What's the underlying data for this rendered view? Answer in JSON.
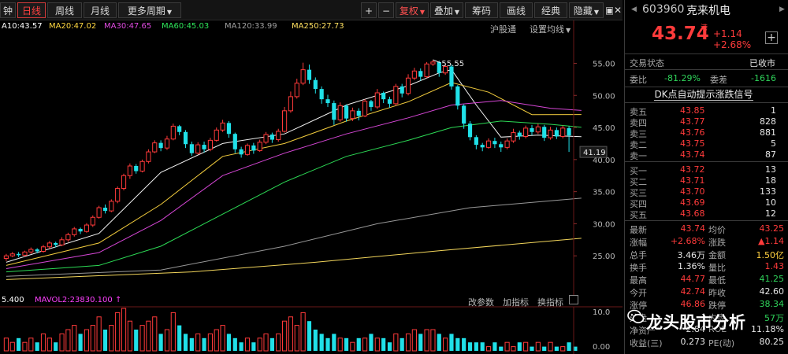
{
  "toolbar": {
    "tabs": [
      "钟",
      "日线",
      "周线",
      "月线",
      "更多周期"
    ],
    "active_tab": "日线",
    "buttons": [
      "+",
      "−",
      "复权",
      "叠加",
      "筹码",
      "画线",
      "经典",
      "隐藏"
    ],
    "window": [
      "▣",
      "✕"
    ]
  },
  "ma_legend": [
    {
      "text": "A10:43.57",
      "color": "#ffffff"
    },
    {
      "text": "MA20:47.02",
      "color": "#ffd740"
    },
    {
      "text": "MA30:47.65",
      "color": "#e04ae0"
    },
    {
      "text": "MA60:45.03",
      "color": "#2ee65a"
    },
    {
      "text": "MA120:33.99",
      "color": "#a0a0a0"
    },
    {
      "text": "MA250:27.73",
      "color": "#ffe060"
    }
  ],
  "right_links": [
    "沪股通",
    "设置均线"
  ],
  "axis": {
    "price_ticks": [
      "55.00",
      "50.00",
      "45.00",
      "40.00",
      "35.00",
      "30.00",
      "25.00"
    ],
    "current_price_label": "41.19",
    "high_marker": "55.55",
    "vol_ticks": [
      "10.0",
      "0.00"
    ]
  },
  "vol_header": {
    "left": "5.400",
    "mavol2": "MAVOL2:23830.100",
    "links": [
      "改参数",
      "加指标",
      "换指标"
    ]
  },
  "chart_data": {
    "type": "candlestick",
    "ylim": [
      20,
      58
    ],
    "high_point": 55.55,
    "candles": [
      [
        24.6,
        25.0,
        24.2,
        25.3
      ],
      [
        25.0,
        25.3,
        24.8,
        25.6
      ],
      [
        25.3,
        25.1,
        24.8,
        25.6
      ],
      [
        25.1,
        25.6,
        24.9,
        25.8
      ],
      [
        25.6,
        26.0,
        25.3,
        26.3
      ],
      [
        26.0,
        25.7,
        25.4,
        26.2
      ],
      [
        25.7,
        26.4,
        25.5,
        26.7
      ],
      [
        26.4,
        27.0,
        26.1,
        27.3
      ],
      [
        27.0,
        26.7,
        26.3,
        27.2
      ],
      [
        26.7,
        27.5,
        26.5,
        27.9
      ],
      [
        27.5,
        28.3,
        27.2,
        28.6
      ],
      [
        28.3,
        29.2,
        28.0,
        29.5
      ],
      [
        29.2,
        28.8,
        28.4,
        29.4
      ],
      [
        28.8,
        29.8,
        28.6,
        30.1
      ],
      [
        29.8,
        31.0,
        29.5,
        31.3
      ],
      [
        31.0,
        32.5,
        30.8,
        32.8
      ],
      [
        32.5,
        32.0,
        31.6,
        33.0
      ],
      [
        32.0,
        33.5,
        31.8,
        33.8
      ],
      [
        33.5,
        35.5,
        33.2,
        35.8
      ],
      [
        35.5,
        37.5,
        35.2,
        37.8
      ],
      [
        37.5,
        39.0,
        37.0,
        39.4
      ],
      [
        39.0,
        38.2,
        37.8,
        39.3
      ],
      [
        38.2,
        39.7,
        38.0,
        40.0
      ],
      [
        39.7,
        41.2,
        39.4,
        41.6
      ],
      [
        41.2,
        42.6,
        41.0,
        43.0
      ],
      [
        42.6,
        41.8,
        41.3,
        43.0
      ],
      [
        41.8,
        43.2,
        41.5,
        43.7
      ],
      [
        43.2,
        45.2,
        43.0,
        45.6
      ],
      [
        45.2,
        44.3,
        43.8,
        45.4
      ],
      [
        44.3,
        42.4,
        41.8,
        44.6
      ],
      [
        42.4,
        41.0,
        40.6,
        42.8
      ],
      [
        41.0,
        42.3,
        40.8,
        42.7
      ],
      [
        42.3,
        41.6,
        41.1,
        42.8
      ],
      [
        41.6,
        43.0,
        41.3,
        43.4
      ],
      [
        43.0,
        44.6,
        42.8,
        45.0
      ],
      [
        44.6,
        45.7,
        44.3,
        46.2
      ],
      [
        45.7,
        44.0,
        43.4,
        46.0
      ],
      [
        44.0,
        41.6,
        41.0,
        44.2
      ],
      [
        41.6,
        40.8,
        40.3,
        42.0
      ],
      [
        40.8,
        42.2,
        40.6,
        42.5
      ],
      [
        42.2,
        41.4,
        40.9,
        42.6
      ],
      [
        41.4,
        42.7,
        41.2,
        43.1
      ],
      [
        42.7,
        43.9,
        42.4,
        44.3
      ],
      [
        43.9,
        43.1,
        42.6,
        44.2
      ],
      [
        43.1,
        44.4,
        42.8,
        44.8
      ],
      [
        44.4,
        47.6,
        44.2,
        48.2
      ],
      [
        47.6,
        49.8,
        47.3,
        50.6
      ],
      [
        49.8,
        51.9,
        49.5,
        52.6
      ],
      [
        51.9,
        54.0,
        51.6,
        55.1
      ],
      [
        54.0,
        52.4,
        51.8,
        54.8
      ],
      [
        52.4,
        51.0,
        50.3,
        52.8
      ],
      [
        51.0,
        49.4,
        48.7,
        51.4
      ],
      [
        49.4,
        48.8,
        48.2,
        50.1
      ],
      [
        48.8,
        46.2,
        45.4,
        49.2
      ],
      [
        46.2,
        48.4,
        45.9,
        48.9
      ],
      [
        48.4,
        46.4,
        45.9,
        48.6
      ],
      [
        46.4,
        47.6,
        46.0,
        48.1
      ],
      [
        47.6,
        46.8,
        46.1,
        48.0
      ],
      [
        46.8,
        49.1,
        46.6,
        49.4
      ],
      [
        49.1,
        48.2,
        47.6,
        49.3
      ],
      [
        48.2,
        50.4,
        47.9,
        51.0
      ],
      [
        50.4,
        49.4,
        48.8,
        50.6
      ],
      [
        49.4,
        48.7,
        48.1,
        49.8
      ],
      [
        48.7,
        51.4,
        48.4,
        51.8
      ],
      [
        51.4,
        50.3,
        49.7,
        51.8
      ],
      [
        50.3,
        52.7,
        50.0,
        53.3
      ],
      [
        52.7,
        53.8,
        52.4,
        54.3
      ],
      [
        53.8,
        52.9,
        52.3,
        54.2
      ],
      [
        52.9,
        54.9,
        52.7,
        55.2
      ],
      [
        54.9,
        55.2,
        54.6,
        55.55
      ],
      [
        55.2,
        53.5,
        52.9,
        55.4
      ],
      [
        53.5,
        54.5,
        53.2,
        54.9
      ],
      [
        54.5,
        51.4,
        50.9,
        54.8
      ],
      [
        51.4,
        48.4,
        47.8,
        51.6
      ],
      [
        48.4,
        45.6,
        44.8,
        48.6
      ],
      [
        45.6,
        43.5,
        43.0,
        46.0
      ],
      [
        43.5,
        42.3,
        41.6,
        43.8
      ],
      [
        42.3,
        41.9,
        41.3,
        42.6
      ],
      [
        41.9,
        42.9,
        41.7,
        43.3
      ],
      [
        42.9,
        42.4,
        41.8,
        43.4
      ],
      [
        42.4,
        41.9,
        41.2,
        42.8
      ],
      [
        41.9,
        42.9,
        41.6,
        43.3
      ],
      [
        42.9,
        44.2,
        42.6,
        44.8
      ],
      [
        44.2,
        43.6,
        43.1,
        44.5
      ],
      [
        43.6,
        44.9,
        43.3,
        45.3
      ],
      [
        44.9,
        44.3,
        43.8,
        45.4
      ],
      [
        44.3,
        45.1,
        44.0,
        45.6
      ],
      [
        45.1,
        43.4,
        42.9,
        45.4
      ],
      [
        43.4,
        44.6,
        43.1,
        45.1
      ],
      [
        44.6,
        43.6,
        43.2,
        45.0
      ],
      [
        43.6,
        44.9,
        43.3,
        45.3
      ],
      [
        44.9,
        43.74,
        41.19,
        45.2
      ]
    ],
    "ma_series": [
      {
        "name": "MA10",
        "color": "#ffffff",
        "values": [
          [
            0,
            24.0
          ],
          [
            15,
            28.5
          ],
          [
            25,
            38.0
          ],
          [
            35,
            42.5
          ],
          [
            45,
            44.0
          ],
          [
            55,
            48.5
          ],
          [
            65,
            51.5
          ],
          [
            70,
            53.5
          ],
          [
            72,
            54.0
          ],
          [
            76,
            48.5
          ],
          [
            80,
            43.5
          ],
          [
            86,
            43.8
          ],
          [
            93,
            43.57
          ]
        ]
      },
      {
        "name": "MA20",
        "color": "#ffd740",
        "values": [
          [
            0,
            23.5
          ],
          [
            15,
            27.0
          ],
          [
            25,
            33.0
          ],
          [
            35,
            40.5
          ],
          [
            45,
            42.5
          ],
          [
            55,
            46.0
          ],
          [
            65,
            49.0
          ],
          [
            72,
            52.0
          ],
          [
            78,
            50.5
          ],
          [
            85,
            47.0
          ],
          [
            93,
            47.02
          ]
        ]
      },
      {
        "name": "MA30",
        "color": "#e04ae0",
        "values": [
          [
            0,
            23.0
          ],
          [
            15,
            25.5
          ],
          [
            25,
            30.5
          ],
          [
            35,
            37.5
          ],
          [
            45,
            41.0
          ],
          [
            55,
            44.0
          ],
          [
            65,
            46.5
          ],
          [
            72,
            48.5
          ],
          [
            80,
            49.2
          ],
          [
            88,
            48.0
          ],
          [
            93,
            47.65
          ]
        ]
      },
      {
        "name": "MA60",
        "color": "#2ee65a",
        "values": [
          [
            0,
            22.5
          ],
          [
            15,
            23.5
          ],
          [
            25,
            26.5
          ],
          [
            35,
            31.5
          ],
          [
            45,
            36.5
          ],
          [
            55,
            40.5
          ],
          [
            65,
            43.0
          ],
          [
            72,
            45.0
          ],
          [
            80,
            46.0
          ],
          [
            88,
            45.5
          ],
          [
            93,
            45.03
          ]
        ]
      },
      {
        "name": "MA120",
        "color": "#a0a0a0",
        "values": [
          [
            0,
            21.8
          ],
          [
            25,
            22.8
          ],
          [
            45,
            26.5
          ],
          [
            60,
            30.0
          ],
          [
            75,
            32.5
          ],
          [
            93,
            33.99
          ]
        ]
      },
      {
        "name": "MA250",
        "color": "#ffe060",
        "values": [
          [
            0,
            21.3
          ],
          [
            30,
            22.5
          ],
          [
            50,
            24.0
          ],
          [
            70,
            25.8
          ],
          [
            93,
            27.73
          ]
        ]
      }
    ],
    "volume": [
      3,
      2,
      3,
      2,
      3,
      2,
      4,
      3,
      2,
      4,
      5,
      6,
      4,
      5,
      6,
      8,
      5,
      6,
      9,
      10,
      7,
      5,
      6,
      7,
      8,
      4,
      5,
      9,
      6,
      4,
      3,
      4,
      3,
      4,
      5,
      6,
      4,
      3,
      2,
      3,
      2,
      3,
      4,
      3,
      4,
      7,
      8,
      6,
      9,
      7,
      5,
      4,
      3,
      4,
      3,
      3,
      2,
      3,
      3,
      4,
      3,
      3,
      2,
      4,
      3,
      4,
      5,
      4,
      5,
      5,
      4,
      3,
      4,
      3,
      3,
      2,
      2,
      2,
      1,
      2,
      1,
      2,
      1,
      2,
      2,
      1,
      2,
      1,
      2,
      1,
      1,
      2,
      1
    ]
  },
  "panel": {
    "code": "603960",
    "name": "克来机电",
    "price": "43.74",
    "badge": "港",
    "change": "+1.14",
    "change_pct": "+2.68%",
    "status_label": "交易状态",
    "status_value": "已收市",
    "webi_label": "委比",
    "webi_value": "-81.29%",
    "wecha_label": "委差",
    "wecha_value": "-1616",
    "signal": "DK点自动提示涨跌信号",
    "sells": [
      {
        "label": "卖五",
        "price": "43.85",
        "vol": "1"
      },
      {
        "label": "卖四",
        "price": "43.77",
        "vol": "828"
      },
      {
        "label": "卖三",
        "price": "43.76",
        "vol": "881"
      },
      {
        "label": "卖二",
        "price": "43.75",
        "vol": "5"
      },
      {
        "label": "卖一",
        "price": "43.74",
        "vol": "87"
      }
    ],
    "buys": [
      {
        "label": "买一",
        "price": "43.72",
        "vol": "13"
      },
      {
        "label": "买二",
        "price": "43.71",
        "vol": "18"
      },
      {
        "label": "买三",
        "price": "43.70",
        "vol": "133"
      },
      {
        "label": "买四",
        "price": "43.69",
        "vol": "10"
      },
      {
        "label": "买五",
        "price": "43.68",
        "vol": "12"
      }
    ],
    "stats": [
      {
        "l1": "最新",
        "v1": "43.74",
        "c1": "red",
        "l2": "均价",
        "v2": "43.25",
        "c2": "red"
      },
      {
        "l1": "涨幅",
        "v1": "+2.68%",
        "c1": "red",
        "l2": "涨跌",
        "v2": "▲1.14",
        "c2": "red"
      },
      {
        "l1": "总手",
        "v1": "3.46万",
        "c1": "white",
        "l2": "金额",
        "v2": "1.50亿",
        "c2": "yellow"
      },
      {
        "l1": "换手",
        "v1": "1.36%",
        "c1": "white",
        "l2": "量比",
        "v2": "1.43",
        "c2": "red"
      },
      {
        "l1": "最高",
        "v1": "44.77",
        "c1": "red",
        "l2": "最低",
        "v2": "41.25",
        "c2": "green"
      },
      {
        "l1": "今开",
        "v1": "42.74",
        "c1": "red",
        "l2": "昨收",
        "v2": "42.60",
        "c2": "white"
      },
      {
        "l1": "涨停",
        "v1": "46.86",
        "c1": "red",
        "l2": "跌停",
        "v2": "38.34",
        "c2": "green"
      },
      {
        "l1": "外盘",
        "v1": "",
        "c1": "white",
        "l2": "内盘",
        "v2": "57万",
        "c2": "green"
      },
      {
        "l1": "净资产",
        "v1": "2.84",
        "c1": "white",
        "l2": "ROE",
        "v2": "11.18%",
        "c2": "white"
      },
      {
        "l1": "收益(三)",
        "v1": "0.273",
        "c1": "white",
        "l2": "PE(动)",
        "v2": "80.25",
        "c2": "white"
      }
    ]
  },
  "watermark": "龙头股市分析"
}
